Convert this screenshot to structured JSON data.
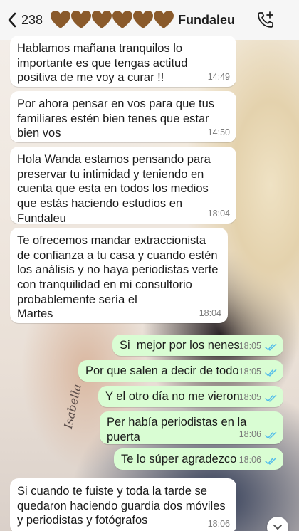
{
  "header": {
    "back_count": "238",
    "contact_name": "Fundaleu",
    "heart_color": "#8a5a2b"
  },
  "messages": [
    {
      "dir": "in",
      "text": "Hablamos mañana tranquilos lo importante es que tengas actitud positiva de me voy a curar !!",
      "time": "14:49"
    },
    {
      "dir": "in",
      "text": "Por ahora pensar en vos para que tus familiares estén bien tenes que estar bien vos",
      "time": "14:50"
    },
    {
      "dir": "in",
      "text": "Hola Wanda estamos pensando para preservar tu intimidad y teniendo en cuenta que esta en todos los medios que estás haciendo estudios en Fundaleu",
      "time": "18:04"
    },
    {
      "dir": "in",
      "text": "Te ofrecemos mandar extraccionista de confianza a tu casa y cuando estén los análisis y no haya periodistas verte con tranquilidad en mi consultorio probablemente sería el\nMartes",
      "time": "18:04"
    },
    {
      "dir": "out",
      "text": "Si  mejor por los nenes",
      "time": "18:05"
    },
    {
      "dir": "out",
      "text": "Por que salen a decir de todo",
      "time": "18:05"
    },
    {
      "dir": "out",
      "text": "Y el otro día no me vieron",
      "time": "18:05"
    },
    {
      "dir": "out",
      "text": "Per había periodistas en la puerta",
      "time": "18:06"
    },
    {
      "dir": "out",
      "text": "Te lo súper agradezco",
      "time": "18:06"
    },
    {
      "dir": "in",
      "text": "Si cuando te fuiste y toda la tarde se quedaron haciendo guardia dos móviles y periodistas y fotógrafos",
      "time": "18:06"
    }
  ],
  "wallpaper": {
    "tattoo_text": "Isabella"
  },
  "colors": {
    "incoming_bubble": "#ffffff",
    "outgoing_bubble": "#d9fdd3",
    "read_ticks": "#53bdeb"
  }
}
